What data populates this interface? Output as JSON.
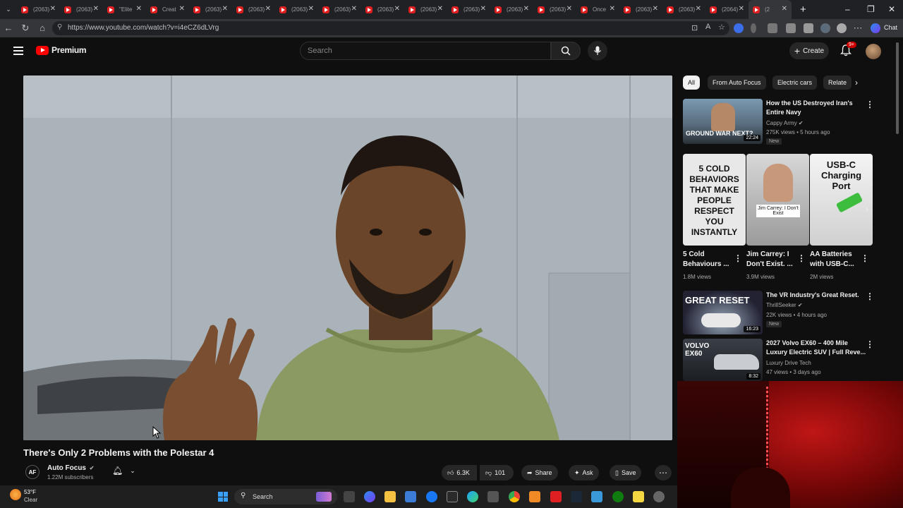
{
  "browser": {
    "tabs": [
      "(2063)",
      "(2063)",
      "\"Elite",
      "Creat",
      "(2063)",
      "(2063)",
      "(2063)",
      "(2063)",
      "(2063)",
      "(2063)",
      "(2063)",
      "(2063)",
      "(2063)",
      "Once",
      "(2063)",
      "(2063)",
      "(2064)",
      "(2"
    ],
    "url": "https://www.youtube.com/watch?v=i4eCZ6dLVrg",
    "chat_label": "Chat"
  },
  "header": {
    "logo_text": "Premium",
    "search_placeholder": "Search",
    "create_label": "Create",
    "notification_count": "9+"
  },
  "video": {
    "title": "There's Only 2 Problems with the Polestar 4",
    "channel_initials": "AF",
    "channel": "Auto Focus",
    "subscribers": "1.22M subscribers",
    "likes": "6.3K",
    "dislikes": "101",
    "share_label": "Share",
    "ask_label": "Ask",
    "save_label": "Save"
  },
  "sidebar": {
    "chips": [
      "All",
      "From Auto Focus",
      "Electric cars",
      "Relate"
    ],
    "recs": [
      {
        "title_line1": "How the US Destroyed Iran's",
        "title_line2": "Entire Navy",
        "channel": "Cappy Army",
        "meta": "275K views • 5 hours ago",
        "badge": "New",
        "thumb_text": "GROUND WAR NEXT?",
        "duration": "22:24"
      },
      {
        "title_line1": "The VR Industry's Great Reset.",
        "title_line2": "",
        "channel": "ThrillSeeker",
        "meta": "22K views • 4 hours ago",
        "badge": "New",
        "thumb_text": "GREAT RESET",
        "duration": "16:23"
      },
      {
        "title_line1": "2027 Volvo EX60 – 400 Mile",
        "title_line2": "Luxury Electric SUV | Full Reve...",
        "channel": "Luxury Drive Tech",
        "meta": "47 views • 3 days ago",
        "badge": "",
        "thumb_text": "VOLVO EX60",
        "duration": "8:32"
      }
    ],
    "shorts": [
      {
        "title_line1": "5 Cold",
        "title_line2": "Behaviours ...",
        "views": "1.8M views",
        "thumb_text": "5 COLD BEHAVIORS THAT MAKE PEOPLE RESPECT YOU INSTANTLY"
      },
      {
        "title_line1": "Jim Carrey: I",
        "title_line2": "Don't Exist. ...",
        "views": "3.9M views",
        "thumb_text": "Jim Carrey: I Don't Exist"
      },
      {
        "title_line1": "AA Batteries",
        "title_line2": "with USB-C...",
        "views": "2M views",
        "thumb_text": "USB-C Charging Port"
      }
    ]
  },
  "taskbar": {
    "weather_temp": "53°F",
    "weather_desc": "Clear",
    "search_label": "Search"
  }
}
